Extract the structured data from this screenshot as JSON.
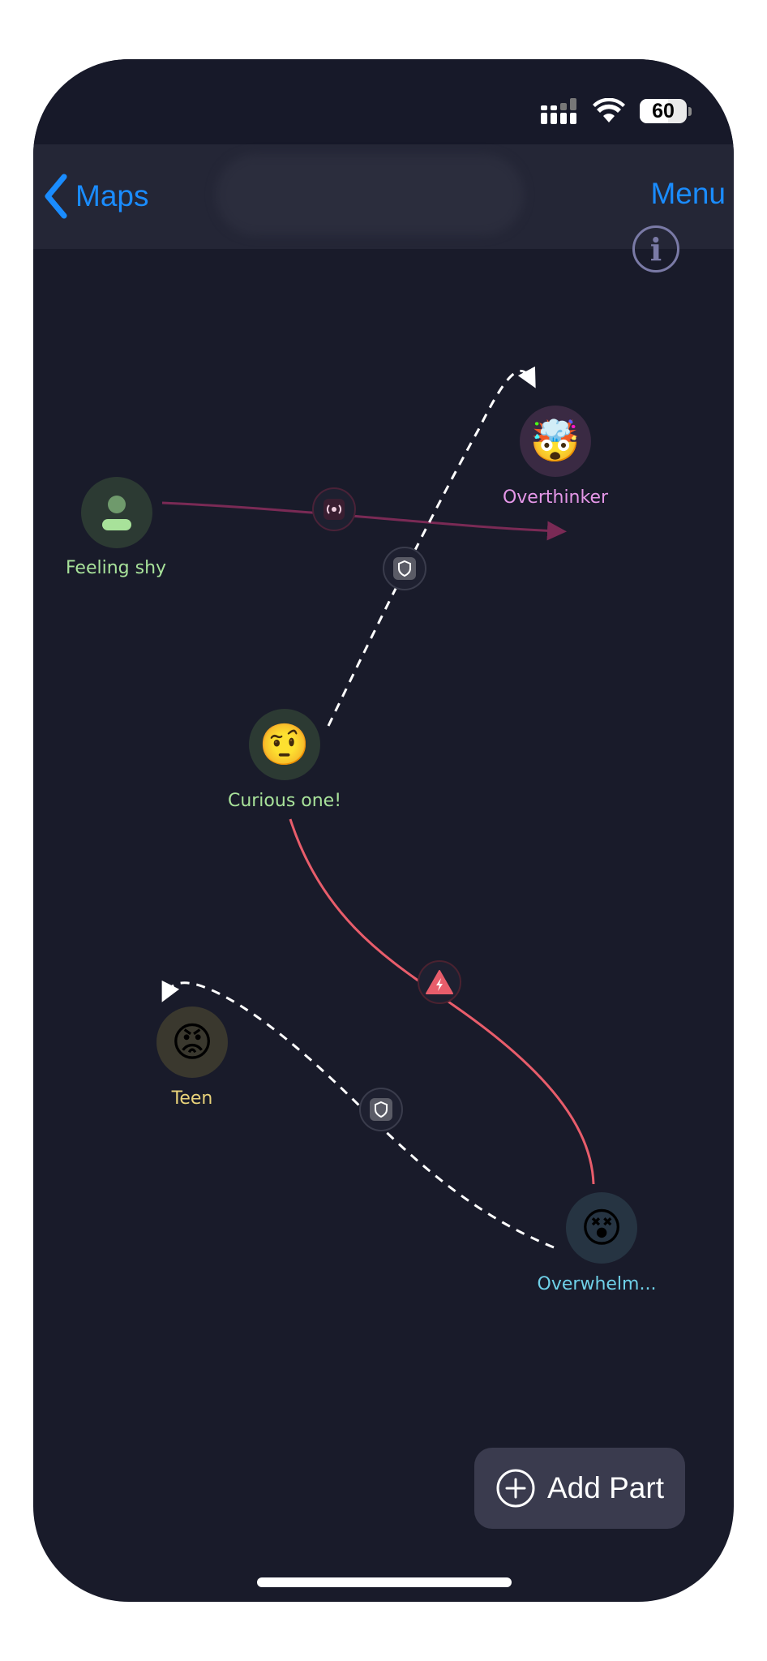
{
  "colors": {
    "canvas": "#191b2a",
    "accent_blue": "#1a8cff",
    "polarized_link": "#7a2a55",
    "conflict_link": "#e85d6b",
    "protective_link": "#ffffff",
    "label_green": "#a8e29a",
    "label_pink": "#e597e8",
    "label_yellow": "#e8d27a",
    "label_cyan": "#6fd0e8"
  },
  "status_bar": {
    "battery_label": "60",
    "battery_level": 0.6,
    "icons": [
      "signal-icon",
      "wifi-icon",
      "battery-icon"
    ]
  },
  "nav": {
    "back_label": "Maps",
    "menu_label": "Menu"
  },
  "info_button": {
    "glyph": "i"
  },
  "parts": [
    {
      "id": "feeling-shy",
      "label": "Feeling shy",
      "icon": "person-icon",
      "color": "#a8e29a"
    },
    {
      "id": "overthinker",
      "label": "Overthinker",
      "emoji": "🤯",
      "color": "#e597e8"
    },
    {
      "id": "curious-one",
      "label": "Curious one!",
      "emoji": "🤨",
      "color": "#a8e29a"
    },
    {
      "id": "teen",
      "label": "Teen",
      "emoji": "😡",
      "color": "#e8d27a"
    },
    {
      "id": "overwhelmed",
      "label": "Overwhelm...",
      "emoji": "😵",
      "color": "#6fd0e8"
    }
  ],
  "relationships": [
    {
      "from": "Feeling shy",
      "to": "Overthinker",
      "type": "polarized",
      "icon": "polarization-icon"
    },
    {
      "from": "Curious one!",
      "to": "Overthinker",
      "type": "protective",
      "icon": "shield-icon"
    },
    {
      "from": "Curious one!",
      "to": "Overwhelm...",
      "type": "conflict",
      "icon": "conflict-icon"
    },
    {
      "from": "Overwhelm...",
      "to": "Teen",
      "type": "protective",
      "icon": "shield-icon"
    }
  ],
  "add_part": {
    "label": "Add Part"
  }
}
